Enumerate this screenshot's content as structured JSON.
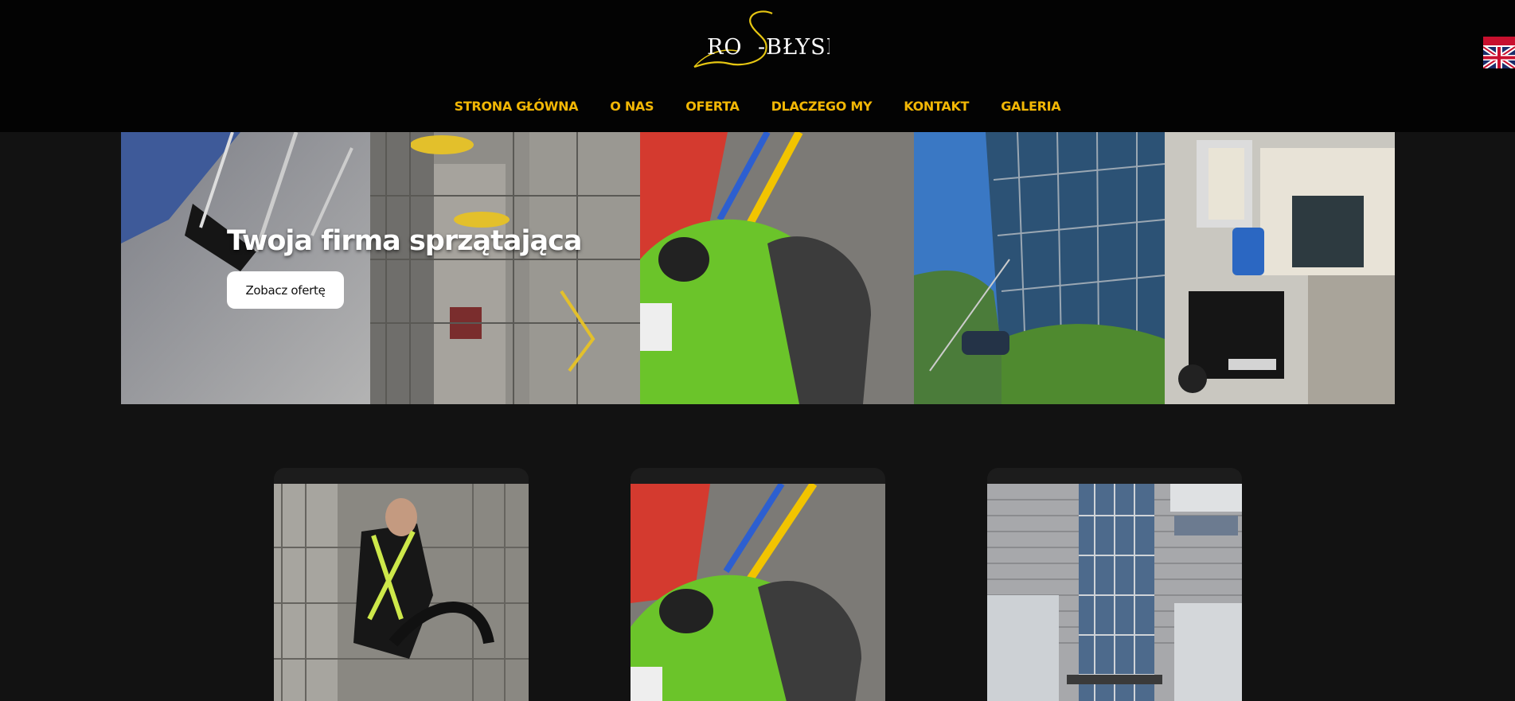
{
  "header": {
    "logo_alt": "ROS-BŁYSK",
    "logo_text_left": "RO",
    "logo_text_right": "-BŁYSK",
    "language_flag": "uk-flag-icon"
  },
  "nav": {
    "items": [
      {
        "label": "STRONA GŁÓWNA"
      },
      {
        "label": "O NAS"
      },
      {
        "label": "OFERTA"
      },
      {
        "label": "DLACZEGO MY"
      },
      {
        "label": "KONTAKT"
      },
      {
        "label": "GALERIA"
      }
    ]
  },
  "hero": {
    "title": "Twoja firma sprzątająca",
    "button_label": "Zobacz ofertę"
  },
  "colors": {
    "nav_accent": "#f2b705",
    "header_bg": "#030303",
    "page_bg": "#121212",
    "logo_swash": "#e6c612"
  }
}
